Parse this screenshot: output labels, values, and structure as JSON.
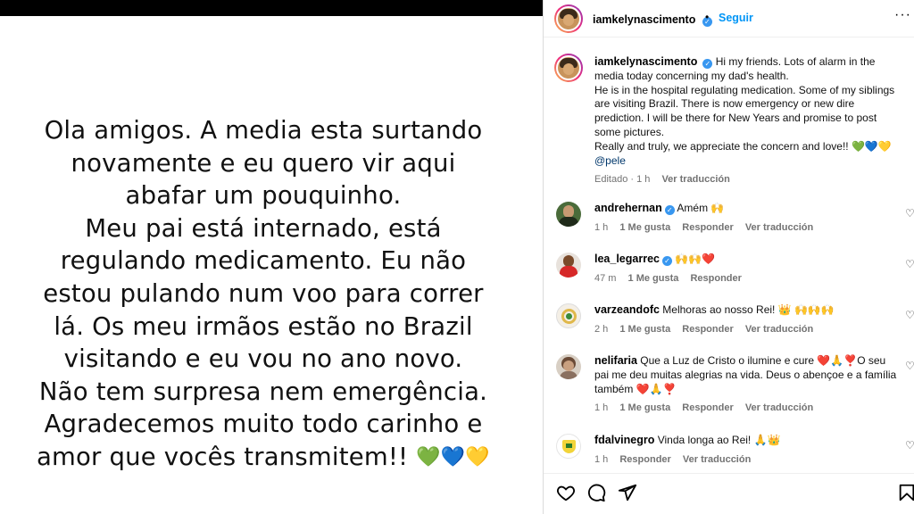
{
  "story": {
    "lines": [
      "Ola amigos. A media esta surtando",
      "novamente e eu quero vir aqui",
      "abafar um pouquinho.",
      "Meu pai está internado, está",
      "regulando medicamento. Eu não",
      "estou pulando num voo para correr",
      "lá. Os meu irmãos estão no Brazil",
      "visitando e eu vou no ano novo.",
      "Não tem surpresa nem emergência.",
      "Agradecemos muito todo carinho e",
      "amor que vocês transmitem!!"
    ],
    "hearts": "💚💙💛"
  },
  "header": {
    "username": "iamkelynascimento",
    "dot": "•",
    "follow_label": "Seguir",
    "more_label": "···"
  },
  "caption": {
    "username": "iamkelynascimento",
    "text1": "Hi my friends. Lots of alarm in the media today concerning my dad's health.",
    "text2": "He is in the hospital regulating medication. Some of my siblings are visiting Brazil. There is now emergency or new dire prediction. I will be there for New Years and promise to post some pictures.",
    "text3": "Really and truly, we appreciate the concern and love!! 💚💙💛",
    "mention": "@pele",
    "meta_time": "Editado · 1 h",
    "meta_translate": "Ver traducción"
  },
  "comments": [
    {
      "username": "andrehernan",
      "verified": true,
      "text": "Amém 🙌",
      "time": "1 h",
      "likes": "1 Me gusta",
      "reply": "Responder",
      "translate": "Ver traducción"
    },
    {
      "username": "lea_legarrec",
      "verified": true,
      "text": "🙌🙌❤️",
      "time": "47 m",
      "likes": "1 Me gusta",
      "reply": "Responder",
      "translate": ""
    },
    {
      "username": "varzeandofc",
      "verified": false,
      "text": "Melhoras ao nosso Rei! 👑 🙌🙌🙌",
      "time": "2 h",
      "likes": "1 Me gusta",
      "reply": "Responder",
      "translate": "Ver traducción"
    },
    {
      "username": "nelifaria",
      "verified": false,
      "text": "Que a Luz de Cristo o ilumine e cure ❤️🙏❣️O seu pai me deu muitas alegrias na vida. Deus o abençoe e a família também ❤️🙏❣️",
      "time": "1 h",
      "likes": "1 Me gusta",
      "reply": "Responder",
      "translate": "Ver traducción"
    },
    {
      "username": "fdalvinegro",
      "verified": false,
      "text": "Vinda longa ao Rei! 🙏👑",
      "time": "1 h",
      "likes": "",
      "reply": "Responder",
      "translate": "Ver traducción"
    }
  ],
  "colors": {
    "link_blue": "#0095f6",
    "verified_blue": "#3897f0",
    "meta_gray": "#737373",
    "divider": "#dbdbdb"
  },
  "icons": [
    "heart-icon",
    "comment-icon",
    "share-icon",
    "save-icon",
    "more-icon",
    "verified-icon"
  ]
}
